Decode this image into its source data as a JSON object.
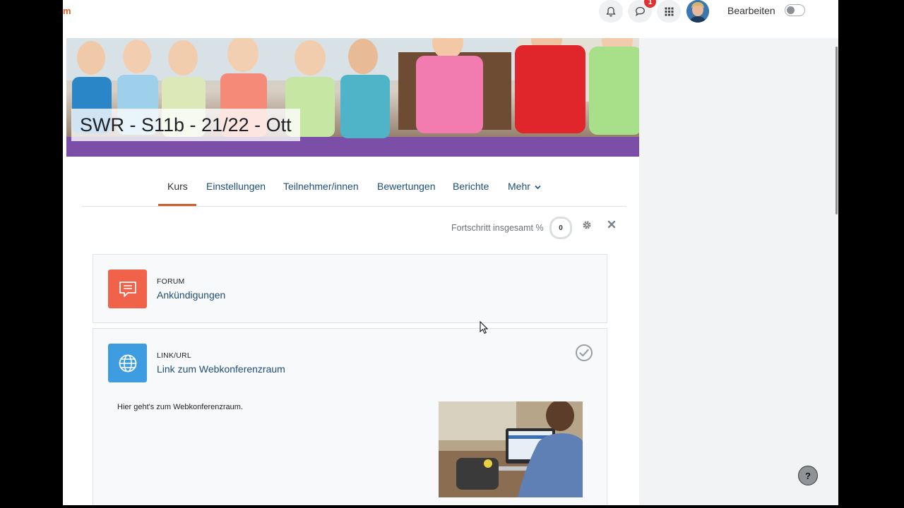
{
  "topbar": {
    "brand_fragment": "m",
    "notifications_count": "1",
    "edit_label": "Bearbeiten"
  },
  "course": {
    "title": "SWR - S11b - 21/22 - Ott"
  },
  "tabs": [
    {
      "label": "Kurs",
      "active": true
    },
    {
      "label": "Einstellungen",
      "active": false
    },
    {
      "label": "Teilnehmer/innen",
      "active": false
    },
    {
      "label": "Bewertungen",
      "active": false
    },
    {
      "label": "Berichte",
      "active": false
    },
    {
      "label": "Mehr",
      "active": false
    }
  ],
  "progress": {
    "label": "Fortschritt insgesamt %",
    "value": "0"
  },
  "activities": [
    {
      "type": "FORUM",
      "name": "Ankündigungen",
      "icon": "forum-icon",
      "color": "#f0634a"
    },
    {
      "type": "LINK/URL",
      "name": "Link zum Webkonferenzraum",
      "icon": "globe-icon",
      "color": "#3e9de0"
    }
  ],
  "description": {
    "text": "Hier geht's zum Webkonferenzraum."
  },
  "help": {
    "label": "?"
  },
  "colors": {
    "accent": "#d05c2a",
    "link": "#1e4e79"
  }
}
